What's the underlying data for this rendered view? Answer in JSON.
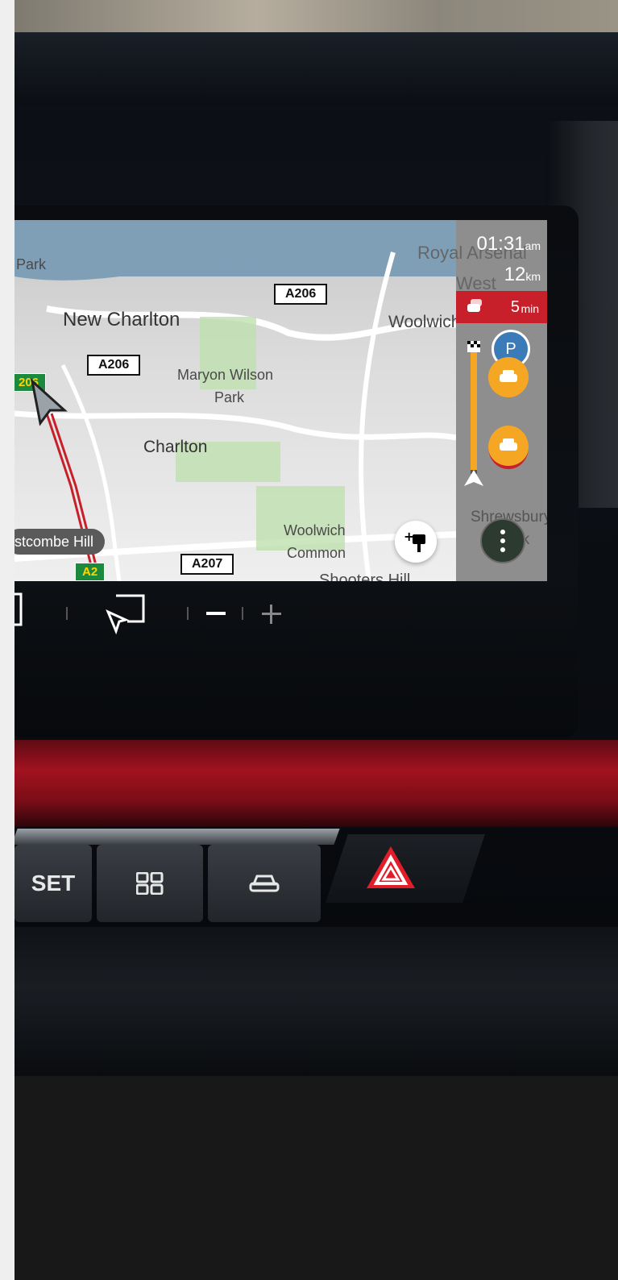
{
  "map": {
    "places": [
      "Park",
      "New Charlton",
      "Maryon Wilson",
      "Park",
      "Charlton",
      "Woolwich",
      "Common",
      "Royal Arsenal",
      "West",
      "Woolwich",
      "Shrewsbury",
      "Park",
      "Shooters Hill"
    ],
    "roads": [
      "A206",
      "A206",
      "A207",
      "A2",
      "206"
    ],
    "street_label": "stcombe Hill"
  },
  "panel": {
    "time": "01:31",
    "time_suffix": "am",
    "distance": "12",
    "distance_unit": "km",
    "delay": "5",
    "delay_unit": "min",
    "parking_letter": "P"
  },
  "buttons": {
    "set_label": "SET"
  },
  "colors": {
    "traffic_red": "#c8202a",
    "incident_orange": "#f5a623",
    "trim_red": "#a1121f",
    "road_sign_green": "#1c8a3c"
  },
  "icons": [
    "add-poi-icon",
    "more-options-icon",
    "parking-icon",
    "car-incident-icon",
    "traffic-jam-icon",
    "destination-flag-icon",
    "route-arrow-icon",
    "screen-mirror-icon",
    "zoom-out-icon",
    "zoom-in-icon",
    "grid-icon",
    "car-icon",
    "hazard-icon",
    "cursor-icon"
  ]
}
